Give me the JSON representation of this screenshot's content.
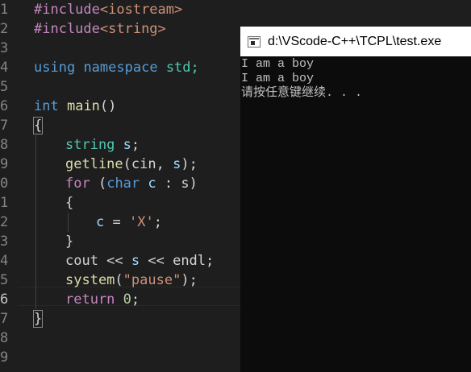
{
  "editor": {
    "line_numbers": [
      "1",
      "2",
      "3",
      "4",
      "5",
      "6",
      "7",
      "8",
      "9",
      "0",
      "1",
      "2",
      "3",
      "4",
      "5",
      "6",
      "7",
      "8",
      "9"
    ],
    "lines": [
      {
        "t": "#include",
        "inc": "<iostream>"
      },
      {
        "t": "#include",
        "inc": "<string>"
      },
      {},
      {
        "a": "using",
        "b": "namespace",
        "c": "std;"
      },
      {},
      {
        "a": "int",
        "b": "main",
        "c": "()"
      },
      {
        "brace": "{"
      },
      {
        "a": "string",
        "b": "s",
        "c": ";"
      },
      {
        "a": "getline",
        "b": "(cin, ",
        "c": "s",
        "d": ");"
      },
      {
        "a": "for",
        "b": " (",
        "c": "char",
        "d": "c",
        "e": " : s)"
      },
      {
        "brace": "{"
      },
      {
        "a": "c",
        "b": " = ",
        "c": "'X'",
        "d": ";"
      },
      {
        "brace": "}"
      },
      {
        "a": "cout << ",
        "b": "s",
        "c": " << endl;"
      },
      {
        "a": "system",
        "b": "(",
        "c": "\"pause\"",
        "d": ");"
      },
      {
        "a": "return",
        "b": "0",
        "c": ";"
      },
      {
        "brace": "}"
      },
      {},
      {}
    ]
  },
  "console": {
    "title": "d:\\VScode-C++\\TCPL\\test.exe",
    "output": [
      "I am a boy",
      "I am a boy",
      "请按任意键继续. . ."
    ]
  }
}
